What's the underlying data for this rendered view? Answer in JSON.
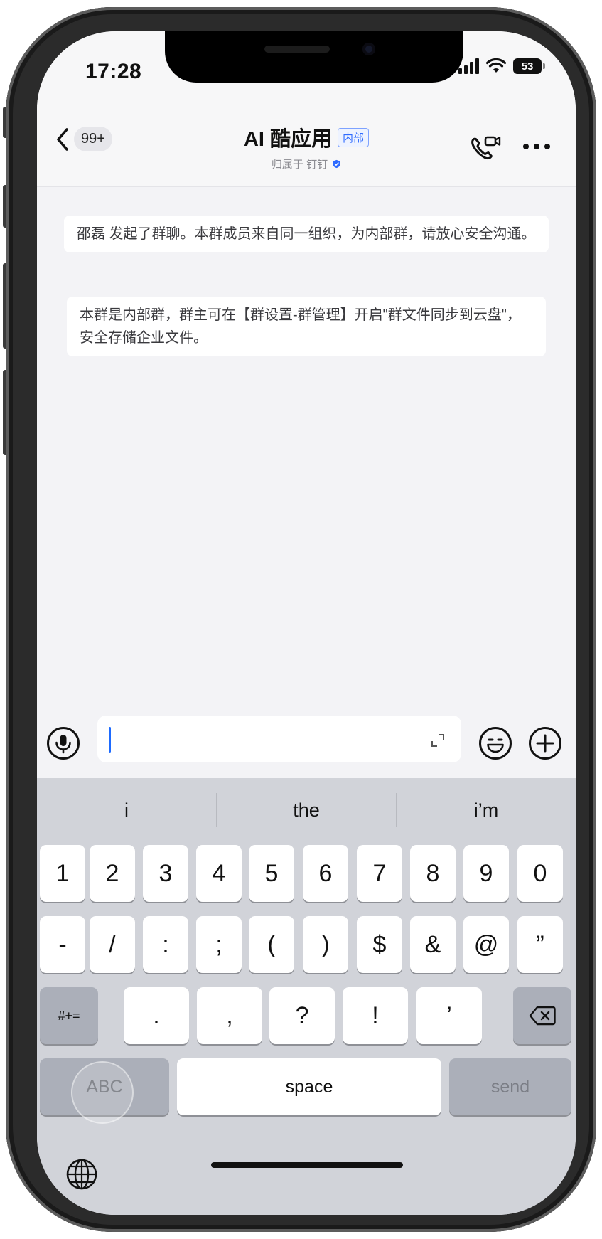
{
  "status_bar": {
    "time": "17:28",
    "battery": "53"
  },
  "header": {
    "back_badge": "99+",
    "title": "AI 酷应用",
    "tag": "内部",
    "subtitle": "归属于 钉钉"
  },
  "chat": {
    "messages": [
      "邵磊 发起了群聊。本群成员来自同一组织，为内部群，请放心安全沟通。",
      "本群是内部群，群主可在【群设置-群管理】开启\"群文件同步到云盘\"，安全存储企业文件。"
    ]
  },
  "input": {
    "value": ""
  },
  "keyboard": {
    "suggestions": [
      "i",
      "the",
      "i’m"
    ],
    "row1": [
      "1",
      "2",
      "3",
      "4",
      "5",
      "6",
      "7",
      "8",
      "9",
      "0"
    ],
    "row2": [
      "-",
      "/",
      ":",
      ";",
      "(",
      ")",
      "$",
      "&",
      "@",
      "”"
    ],
    "row3": [
      "#+=",
      ".",
      ",",
      "?",
      "!",
      "’"
    ],
    "abc": "ABC",
    "space": "space",
    "send": "send"
  },
  "colors": {
    "accent": "#2f6bff",
    "keyboard_bg": "#d1d3d9",
    "chat_bg": "#f3f3f6"
  }
}
